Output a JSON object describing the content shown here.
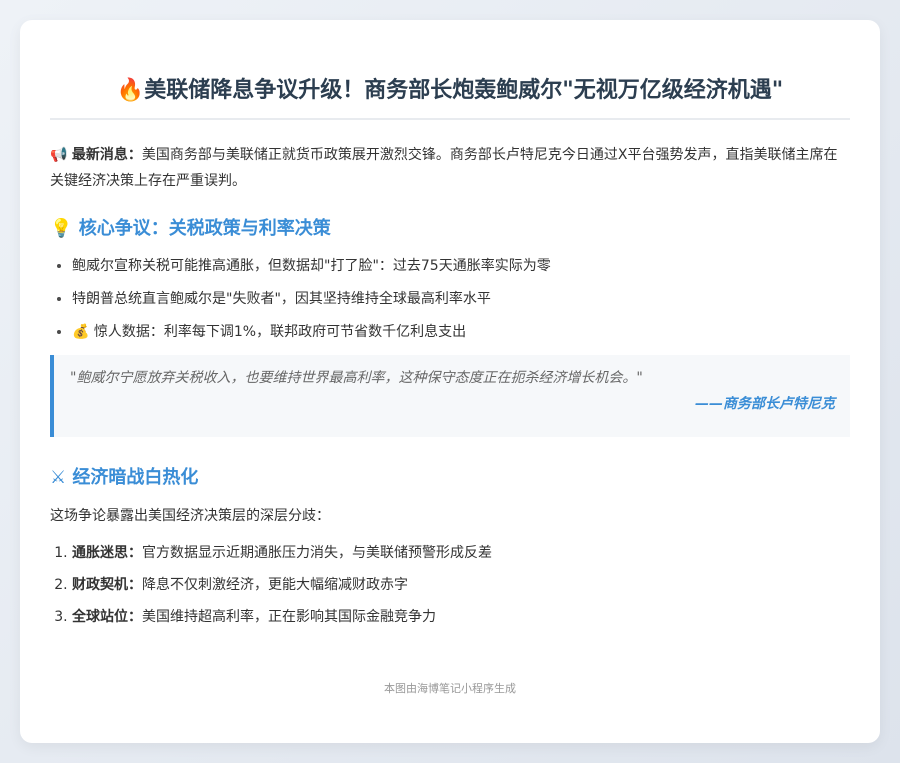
{
  "title": {
    "icon": "fire-icon",
    "text": "美联储降息争议升级！商务部长炮轰鲍威尔\"无视万亿级经济机遇\""
  },
  "news": {
    "icon": "megaphone-icon",
    "label": "最新消息：",
    "text": "美国商务部与美联储正就货币政策展开激烈交锋。商务部长卢特尼克今日通过X平台强势发声，直指美联储主席在关键经济决策上存在严重误判。"
  },
  "section1": {
    "icon": "lightbulb-icon",
    "heading": "核心争议：关税政策与利率决策",
    "points": [
      {
        "icon": "",
        "text": "鲍威尔宣称关税可能推高通胀，但数据却\"打了脸\"：过去75天通胀率实际为零"
      },
      {
        "icon": "",
        "text": "特朗普总统直言鲍威尔是\"失败者\"，因其坚持维持全球最高利率水平"
      },
      {
        "icon": "money-bag-icon",
        "text": "惊人数据：利率每下调1%，联邦政府可节省数千亿利息支出"
      }
    ]
  },
  "quote": {
    "text": "\"鲍威尔宁愿放弃关税收入，也要维持世界最高利率，这种保守态度正在扼杀经济增长机会。\"",
    "source": "——商务部长卢特尼克"
  },
  "section2": {
    "icon": "crossed-swords-icon",
    "heading": "经济暗战白热化",
    "intro": "这场争论暴露出美国经济决策层的深层分歧：",
    "items": [
      {
        "term": "通胀迷思：",
        "text": "官方数据显示近期通胀压力消失，与美联储预警形成反差"
      },
      {
        "term": "财政契机：",
        "text": "降息不仅刺激经济，更能大幅缩减财政赤字"
      },
      {
        "term": "全球站位：",
        "text": "美国维持超高利率，正在影响其国际金融竞争力"
      }
    ]
  },
  "footer": "本图由海博笔记小程序生成",
  "colors": {
    "accent": "#3a8dd6",
    "title": "#2c3e50",
    "quote_bg": "#f6f8fa",
    "background": "#e6eaf0"
  }
}
